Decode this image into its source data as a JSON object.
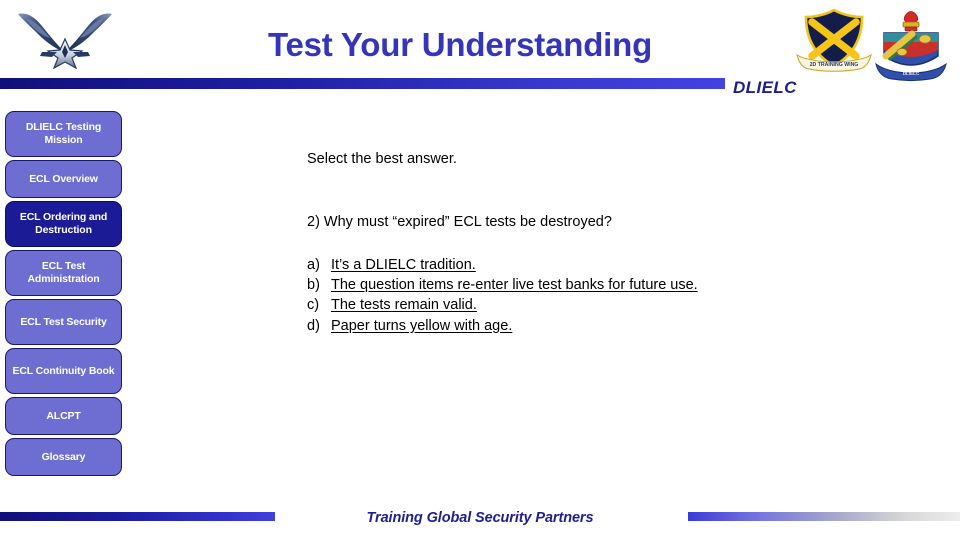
{
  "header": {
    "title": "Test Your Understanding",
    "org_mark": "DLIELC",
    "logo_icon": "air-force-wings-icon",
    "crest_wing_icon": "training-wing-crest-icon",
    "crest_wing_motto": "2D TRAINING WING",
    "crest_dlielc_icon": "dlielc-crest-icon",
    "title_color": "#3434bd",
    "rule_color": "#1d1da0"
  },
  "sidebar": {
    "items": [
      {
        "label": "DLIELC Testing Mission",
        "active": false,
        "name": "sidebar-item-dlielc-testing-mission"
      },
      {
        "label": "ECL Overview",
        "active": false,
        "name": "sidebar-item-ecl-overview"
      },
      {
        "label": "ECL Ordering and Destruction",
        "active": true,
        "name": "sidebar-item-ecl-ordering-and-destruction"
      },
      {
        "label": "ECL Test Administration",
        "active": false,
        "name": "sidebar-item-ecl-test-administration"
      },
      {
        "label": "ECL Test Security",
        "active": false,
        "name": "sidebar-item-ecl-test-security"
      },
      {
        "label": "ECL Continuity Book",
        "active": false,
        "name": "sidebar-item-ecl-continuity-book"
      },
      {
        "label": "ALCPT",
        "active": false,
        "name": "sidebar-item-alcpt"
      },
      {
        "label": "Glossary",
        "active": false,
        "name": "sidebar-item-glossary"
      }
    ],
    "item_color": "#6d6dd2",
    "active_color": "#1b1b96"
  },
  "main": {
    "instruction": "Select the best answer.",
    "question": "2)  Why must “expired” ECL tests be destroyed?",
    "answers": [
      {
        "marker": "a)",
        "text": "It’s a DLIELC tradition."
      },
      {
        "marker": "b)",
        "text": "The question items re-enter live test banks for future use."
      },
      {
        "marker": "c)",
        "text": "The tests remain valid."
      },
      {
        "marker": "d)",
        "text": "Paper turns yellow with age."
      }
    ]
  },
  "footer": {
    "tagline": "Training Global Security Partners"
  }
}
